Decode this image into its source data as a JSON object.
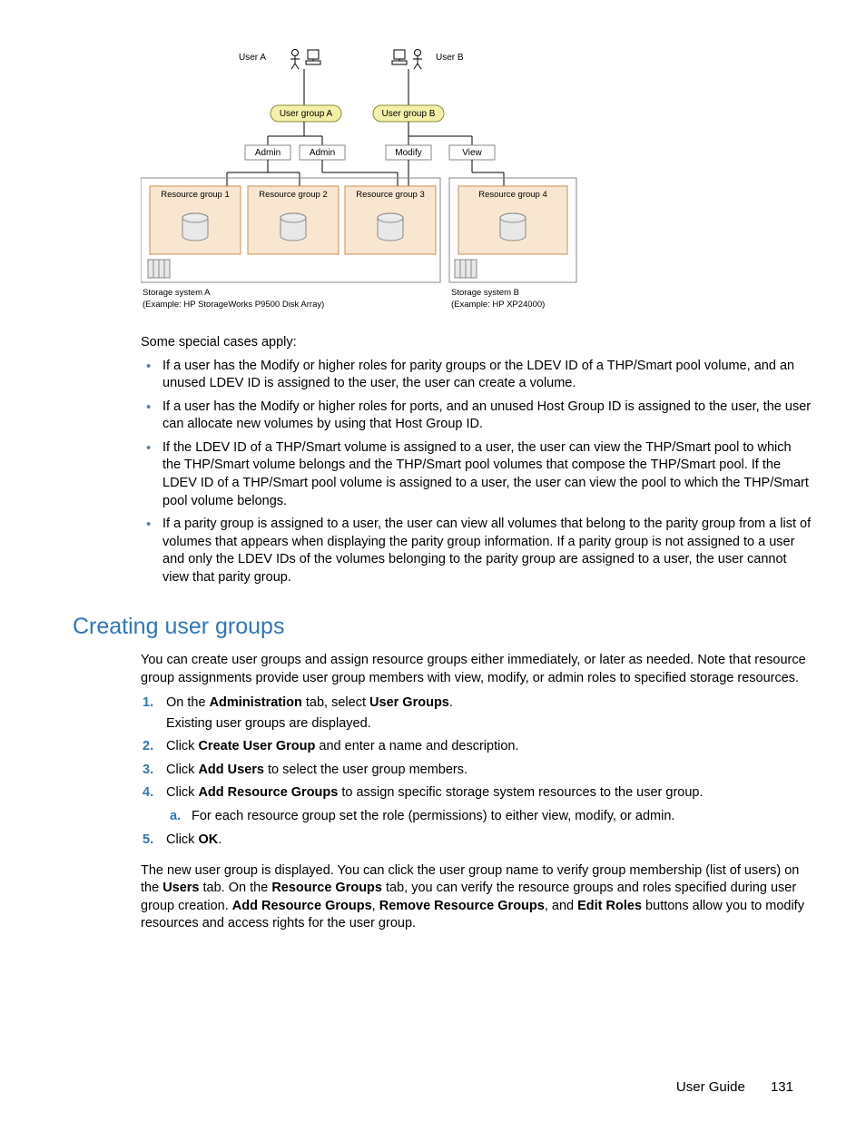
{
  "diagram": {
    "users": {
      "a": "User A",
      "b": "User B"
    },
    "groups": {
      "a": "User group A",
      "b": "User group B"
    },
    "roles": {
      "admin": "Admin",
      "modify": "Modify",
      "view": "View"
    },
    "resource_groups": {
      "r1": "Resource group 1",
      "r2": "Resource group 2",
      "r3": "Resource group 3",
      "r4": "Resource group 4"
    },
    "storage": {
      "a_name": "Storage system A",
      "a_example": "(Example: HP StorageWorks P9500 Disk Array)",
      "b_name": "Storage system B",
      "b_example": "(Example: HP XP24000)"
    }
  },
  "special_intro": "Some special cases apply:",
  "special_cases": [
    "If a user has the Modify or higher roles for parity groups or the LDEV ID of a THP/Smart pool volume, and an unused LDEV ID is assigned to the user, the user can create a volume.",
    "If a user has the Modify or higher roles for ports, and an unused Host Group ID is assigned to the user, the user can allocate new volumes by using that Host Group ID.",
    "If the LDEV ID of a THP/Smart volume is assigned to a user, the user can view the THP/Smart pool to which the THP/Smart volume belongs and the THP/Smart pool volumes that compose the THP/Smart pool. If the LDEV ID of a THP/Smart pool volume is assigned to a user, the user can view the pool to which the THP/Smart pool volume belongs.",
    "If a parity group is assigned to a user, the user can view all volumes that belong to the parity group from a list of volumes that appears when displaying the parity group information. If a parity group is not assigned to a user and only the LDEV IDs of the volumes belonging to the parity group are assigned to a user, the user cannot view that parity group."
  ],
  "heading": "Creating user groups",
  "create_intro": "You can create user groups and assign resource groups either immediately, or later as needed. Note that resource group assignments provide user group members with view, modify, or admin roles to specified storage resources.",
  "steps": {
    "s1_pre": "On the ",
    "s1_b1": "Administration",
    "s1_mid": " tab, select ",
    "s1_b2": "User Groups",
    "s1_post": ".",
    "s1_sub": "Existing user groups are displayed.",
    "s2_pre": "Click ",
    "s2_b": "Create User Group",
    "s2_post": " and enter a name and description.",
    "s3_pre": "Click ",
    "s3_b": "Add Users",
    "s3_post": " to select the user group members.",
    "s4_pre": "Click ",
    "s4_b": "Add Resource Groups",
    "s4_post": " to assign specific storage system resources to the user group.",
    "s4a": "For each resource group set the role (permissions) to either view, modify, or admin.",
    "s5_pre": "Click ",
    "s5_b": "OK",
    "s5_post": "."
  },
  "closing": {
    "t1": "The new user group is displayed. You can click the user group name to verify group membership (list of users) on the ",
    "b1": "Users",
    "t2": " tab. On the ",
    "b2": "Resource Groups",
    "t3": " tab, you can verify the resource groups and roles specified during user group creation. ",
    "b3": "Add Resource Groups",
    "t4": ", ",
    "b4": "Remove Resource Groups",
    "t5": ", and ",
    "b5": "Edit Roles",
    "t6": " buttons allow you to modify resources and access rights for the user group."
  },
  "footer": {
    "label": "User Guide",
    "page": "131"
  }
}
